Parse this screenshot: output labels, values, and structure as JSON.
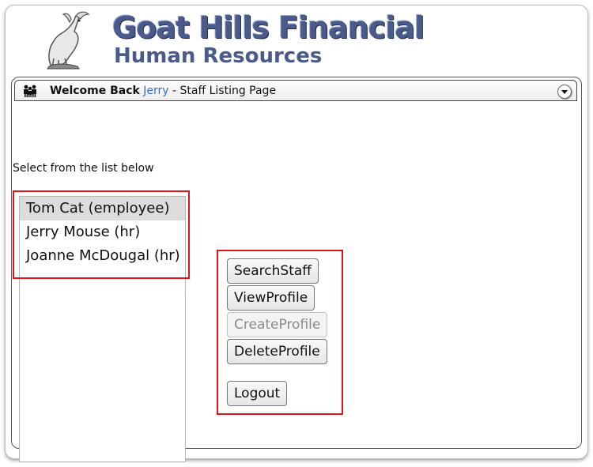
{
  "header": {
    "brand_title": "Goat Hills Financial",
    "brand_subtitle": "Human Resources"
  },
  "panel": {
    "welcome_prefix": "Welcome Back",
    "username": "Jerry",
    "page_suffix": " - Staff Listing Page"
  },
  "instruction": "Select from the list below",
  "staff_list": [
    {
      "label": "Tom Cat (employee)",
      "selected": true
    },
    {
      "label": "Jerry Mouse (hr)",
      "selected": false
    },
    {
      "label": "Joanne McDougal (hr)",
      "selected": false
    }
  ],
  "buttons": {
    "search_staff": "SearchStaff",
    "view_profile": "ViewProfile",
    "create_profile": "CreateProfile",
    "delete_profile": "DeleteProfile",
    "logout": "Logout"
  },
  "colors": {
    "brand": "#4a5a8a",
    "username_link": "#2f6ed8",
    "highlight_border": "#e0141e",
    "selected_row": "#dcdcdc"
  },
  "icons": [
    "goat-logo-icon",
    "people-icon",
    "collapse-icon"
  ]
}
